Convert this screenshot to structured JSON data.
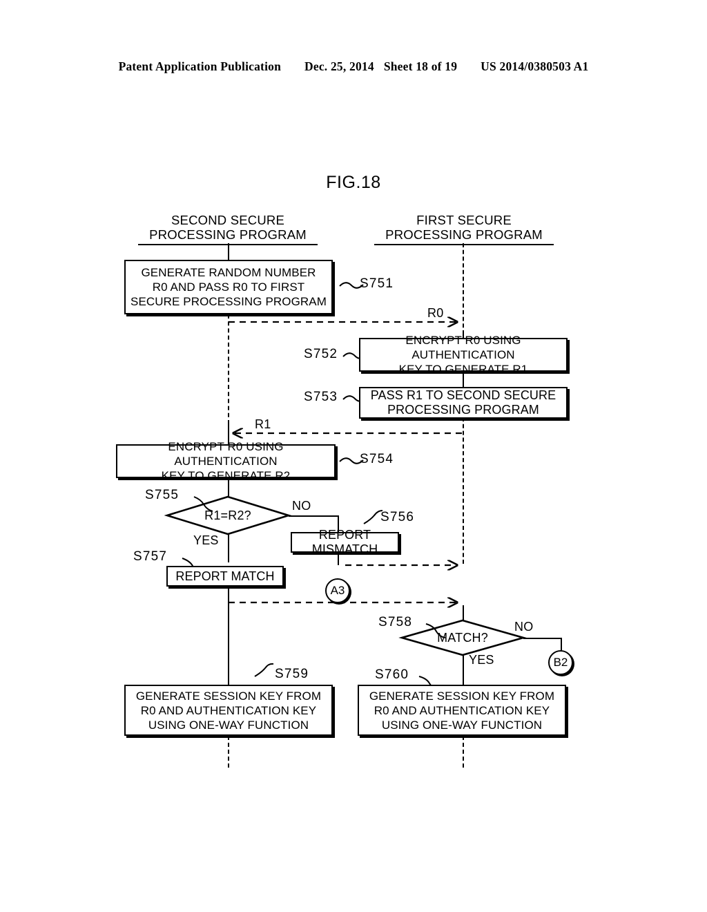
{
  "header": {
    "publication": "Patent Application Publication",
    "date": "Dec. 25, 2014",
    "sheet": "Sheet 18 of 19",
    "doc_number": "US 2014/0380503 A1"
  },
  "figure": {
    "title": "FIG.18"
  },
  "lanes": [
    {
      "id": "second",
      "line1": "SECOND SECURE",
      "line2": "PROCESSING PROGRAM"
    },
    {
      "id": "first",
      "line1": "FIRST SECURE",
      "line2": "PROCESSING PROGRAM"
    }
  ],
  "boxes": [
    {
      "step": "S751",
      "lane": "second",
      "lines": [
        "GENERATE RANDOM NUMBER",
        "R0 AND PASS R0 TO FIRST",
        "SECURE PROCESSING PROGRAM"
      ]
    },
    {
      "step": "S752",
      "lane": "first",
      "lines": [
        "ENCRYPT R0 USING AUTHENTICATION",
        "KEY TO GENERATE R1"
      ]
    },
    {
      "step": "S753",
      "lane": "first",
      "lines": [
        "PASS R1 TO SECOND SECURE",
        "PROCESSING PROGRAM"
      ]
    },
    {
      "step": "S754",
      "lane": "second",
      "lines": [
        "ENCRYPT R0 USING AUTHENTICATION",
        "KEY TO GENERATE R2"
      ]
    },
    {
      "step": "S756",
      "lane": "second",
      "lines": [
        "REPORT MISMATCH"
      ]
    },
    {
      "step": "S757",
      "lane": "second",
      "lines": [
        "REPORT MATCH"
      ]
    },
    {
      "step": "S759",
      "lane": "second",
      "lines": [
        "GENERATE SESSION KEY FROM",
        "R0 AND AUTHENTICATION KEY",
        "USING  ONE-WAY FUNCTION"
      ]
    },
    {
      "step": "S760",
      "lane": "first",
      "lines": [
        "GENERATE SESSION KEY FROM",
        "R0 AND AUTHENTICATION KEY",
        "USING ONE-WAY FUNCTION"
      ]
    }
  ],
  "decisions": [
    {
      "step": "S755",
      "lane": "second",
      "label": "R1=R2?",
      "yes": "YES",
      "no": "NO"
    },
    {
      "step": "S758",
      "lane": "first",
      "label": "MATCH?",
      "yes": "YES",
      "no": "NO"
    }
  ],
  "connectors": [
    {
      "id": "a3",
      "label": "A3"
    },
    {
      "id": "b2",
      "label": "B2"
    }
  ],
  "messages": [
    {
      "id": "r0",
      "label": "R0",
      "direction": "second-to-first"
    },
    {
      "id": "r1",
      "label": "R1",
      "direction": "first-to-second"
    }
  ],
  "steps": {
    "s751": "S751",
    "s752": "S752",
    "s753": "S753",
    "s754": "S754",
    "s755": "S755",
    "s756": "S756",
    "s757": "S757",
    "s758": "S758",
    "s759": "S759",
    "s760": "S760"
  },
  "text": {
    "b_s751_l1": "GENERATE RANDOM NUMBER",
    "b_s751_l2": "R0 AND PASS R0 TO FIRST",
    "b_s751_l3": "SECURE PROCESSING PROGRAM",
    "b_s752_l1": "ENCRYPT R0 USING AUTHENTICATION",
    "b_s752_l2": "KEY TO GENERATE R1",
    "b_s753_l1": "PASS R1 TO SECOND SECURE",
    "b_s753_l2": "PROCESSING PROGRAM",
    "b_s754_l1": "ENCRYPT R0 USING AUTHENTICATION",
    "b_s754_l2": "KEY TO GENERATE R2",
    "b_s756_l1": "REPORT MISMATCH",
    "b_s757_l1": "REPORT MATCH",
    "b_s759_l1": "GENERATE SESSION KEY FROM",
    "b_s759_l2": "R0 AND AUTHENTICATION KEY",
    "b_s759_l3": "USING  ONE-WAY FUNCTION",
    "b_s760_l1": "GENERATE SESSION KEY FROM",
    "b_s760_l2": "R0 AND AUTHENTICATION KEY",
    "b_s760_l3": "USING ONE-WAY FUNCTION",
    "d_s755": "R1=R2?",
    "d_s758": "MATCH?",
    "yes_1": "YES",
    "no_1": "NO",
    "yes_2": "YES",
    "no_2": "NO",
    "msg_r0": "R0",
    "msg_r1": "R1",
    "conn_a3": "A3",
    "conn_b2": "B2",
    "lane_second_l1": "SECOND SECURE",
    "lane_second_l2": "PROCESSING PROGRAM",
    "lane_first_l1": "FIRST SECURE",
    "lane_first_l2": "PROCESSING PROGRAM"
  }
}
